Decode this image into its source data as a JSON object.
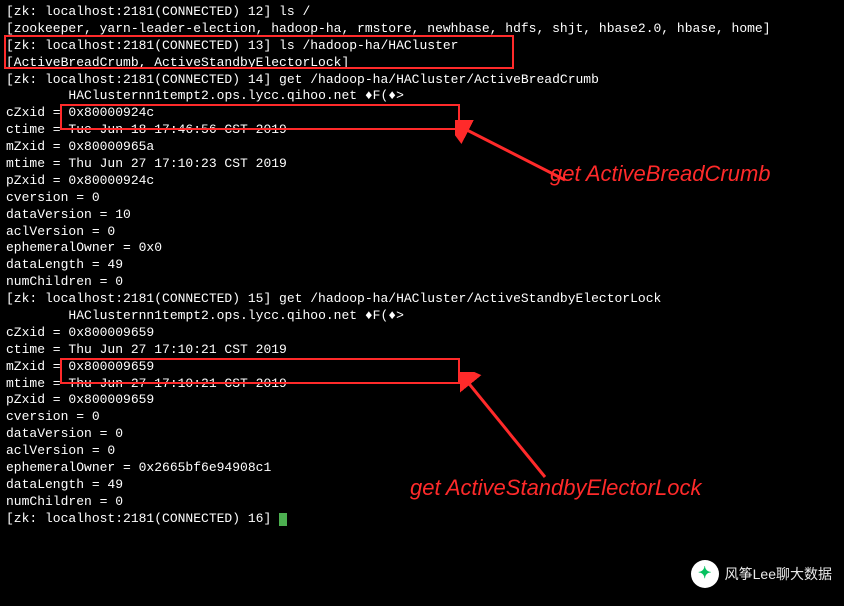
{
  "terminal": {
    "lines": [
      "[zk: localhost:2181(CONNECTED) 12] ls /",
      "[zookeeper, yarn-leader-election, hadoop-ha, rmstore, newhbase, hdfs, shjt, hbase2.0, hbase, home]",
      "[zk: localhost:2181(CONNECTED) 13] ls /hadoop-ha/HACluster",
      "[ActiveBreadCrumb, ActiveStandbyElectorLock]",
      "[zk: localhost:2181(CONNECTED) 14] get /hadoop-ha/HACluster/ActiveBreadCrumb",
      "",
      "\tHAClusternn1tempt2.ops.lycc.qihoo.net ♦F(♦>",
      "cZxid = 0x80000924c",
      "ctime = Tue Jun 18 17:46:56 CST 2019",
      "mZxid = 0x80000965a",
      "mtime = Thu Jun 27 17:10:23 CST 2019",
      "pZxid = 0x80000924c",
      "cversion = 0",
      "dataVersion = 10",
      "aclVersion = 0",
      "ephemeralOwner = 0x0",
      "dataLength = 49",
      "numChildren = 0",
      "[zk: localhost:2181(CONNECTED) 15] get /hadoop-ha/HACluster/ActiveStandbyElectorLock",
      "",
      "\tHAClusternn1tempt2.ops.lycc.qihoo.net ♦F(♦>",
      "cZxid = 0x800009659",
      "ctime = Thu Jun 27 17:10:21 CST 2019",
      "mZxid = 0x800009659",
      "mtime = Thu Jun 27 17:10:21 CST 2019",
      "pZxid = 0x800009659",
      "cversion = 0",
      "dataVersion = 0",
      "aclVersion = 0",
      "ephemeralOwner = 0x2665bf6e94908c1",
      "dataLength = 49",
      "numChildren = 0",
      "[zk: localhost:2181(CONNECTED) 16] "
    ]
  },
  "annotations": {
    "a1": "get ActiveBreadCrumb",
    "a2": "get ActiveStandbyElectorLock"
  },
  "watermark": {
    "text": "风筝Lee聊大数据"
  }
}
